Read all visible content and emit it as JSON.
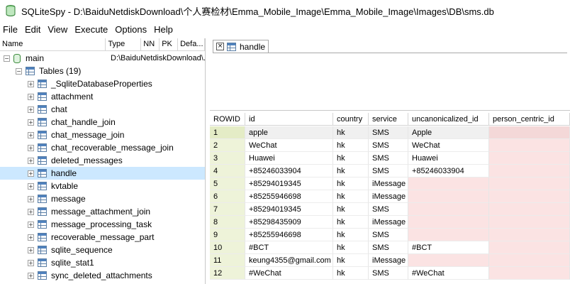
{
  "window": {
    "title": "SQLiteSpy - D:\\BaiduNetdiskDownload\\个人赛检材\\Emma_Mobile_Image\\Emma_Mobile_Image\\Images\\DB\\sms.db"
  },
  "menu": [
    "File",
    "Edit",
    "View",
    "Execute",
    "Options",
    "Help"
  ],
  "tree": {
    "columns": [
      "Name",
      "Type",
      "NN",
      "PK",
      "Defa..."
    ],
    "db": {
      "name": "main",
      "path": "D:\\BaiduNetdiskDownload\\..."
    },
    "group_label": "Tables (19)",
    "tables": [
      "_SqliteDatabaseProperties",
      "attachment",
      "chat",
      "chat_handle_join",
      "chat_message_join",
      "chat_recoverable_message_join",
      "deleted_messages",
      "handle",
      "kvtable",
      "message",
      "message_attachment_join",
      "message_processing_task",
      "recoverable_message_part",
      "sqlite_sequence",
      "sqlite_stat1",
      "sync_deleted_attachments"
    ],
    "selected": "handle"
  },
  "tab": {
    "label": "handle"
  },
  "grid": {
    "columns": [
      "ROWID",
      "id",
      "country",
      "service",
      "uncanonicalized_id",
      "person_centric_id"
    ],
    "rows": [
      [
        "1",
        "apple",
        "hk",
        "SMS",
        "Apple",
        ""
      ],
      [
        "2",
        "WeChat",
        "hk",
        "SMS",
        "WeChat",
        ""
      ],
      [
        "3",
        "Huawei",
        "hk",
        "SMS",
        "Huawei",
        ""
      ],
      [
        "4",
        "+85246033904",
        "hk",
        "SMS",
        "+85246033904",
        ""
      ],
      [
        "5",
        "+85294019345",
        "hk",
        "iMessage",
        "",
        ""
      ],
      [
        "6",
        "+85255946698",
        "hk",
        "iMessage",
        "",
        ""
      ],
      [
        "7",
        "+85294019345",
        "hk",
        "SMS",
        "",
        ""
      ],
      [
        "8",
        "+85298435909",
        "hk",
        "iMessage",
        "",
        ""
      ],
      [
        "9",
        "+85255946698",
        "hk",
        "SMS",
        "",
        ""
      ],
      [
        "10",
        "#BCT",
        "hk",
        "SMS",
        "#BCT",
        ""
      ],
      [
        "11",
        "keung4355@gmail.com",
        "hk",
        "iMessage",
        "",
        ""
      ],
      [
        "12",
        "#WeChat",
        "hk",
        "SMS",
        "#WeChat",
        ""
      ]
    ],
    "null_color": "#fbe3e3",
    "rowid_color": "#eef3d9"
  },
  "icons": {
    "app": "sqlitespy-icon",
    "db": "database-icon",
    "table": "table-icon",
    "expander": "plus-box-icon",
    "close": "close-icon"
  }
}
